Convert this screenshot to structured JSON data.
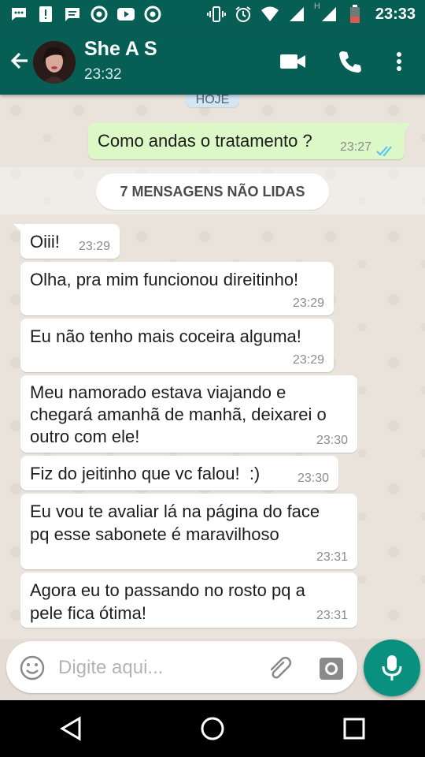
{
  "status_bar": {
    "time": "23:33",
    "network_label": "H",
    "left_icons": [
      "message-bubble-icon",
      "alert-icon",
      "sms-icon",
      "chrome-icon",
      "youtube-icon",
      "chrome-icon"
    ],
    "right_icons": [
      "vibrate-icon",
      "alarm-icon",
      "wifi-icon",
      "signal-icon",
      "signal-h-icon",
      "battery-icon"
    ]
  },
  "header": {
    "contact_name": "She A S",
    "contact_status": "23:32",
    "actions": [
      "video-call-icon",
      "phone-icon",
      "more-vert-icon"
    ]
  },
  "chat": {
    "date_pill": "HOJE",
    "unread_label": "7 MENSAGENS NÃO LIDAS",
    "outgoing": {
      "text": "Como andas o tratamento ?",
      "time": "23:27",
      "status": "delivered-double-check"
    },
    "incoming": [
      {
        "text": "Oiii!",
        "time": "23:29"
      },
      {
        "text": "Olha, pra mim funcionou direitinho!",
        "time": "23:29"
      },
      {
        "text": "Eu não tenho mais coceira alguma!",
        "time": "23:29"
      },
      {
        "text": "Meu namorado estava viajando e\nchegará amanhã de manhã, deixarei o\noutro com ele!",
        "time": "23:30"
      },
      {
        "text": "Fiz do jeitinho que vc falou!  :)",
        "time": "23:30"
      },
      {
        "text": "Eu vou te avaliar lá na página do face\npq esse sabonete é maravilhoso",
        "time": "23:31"
      },
      {
        "text": "Agora eu to passando no rosto pq a\npele fica ótima!",
        "time": "23:31"
      }
    ]
  },
  "composer": {
    "placeholder": "Digite aqui..."
  },
  "colors": {
    "header": "#075e54",
    "outgoing_bubble": "#dcf8c6",
    "incoming_bubble": "#ffffff",
    "mic_button": "#09907e",
    "ticks": "#4fc3f7"
  },
  "nav": [
    "back-icon",
    "home-icon",
    "recents-icon"
  ]
}
